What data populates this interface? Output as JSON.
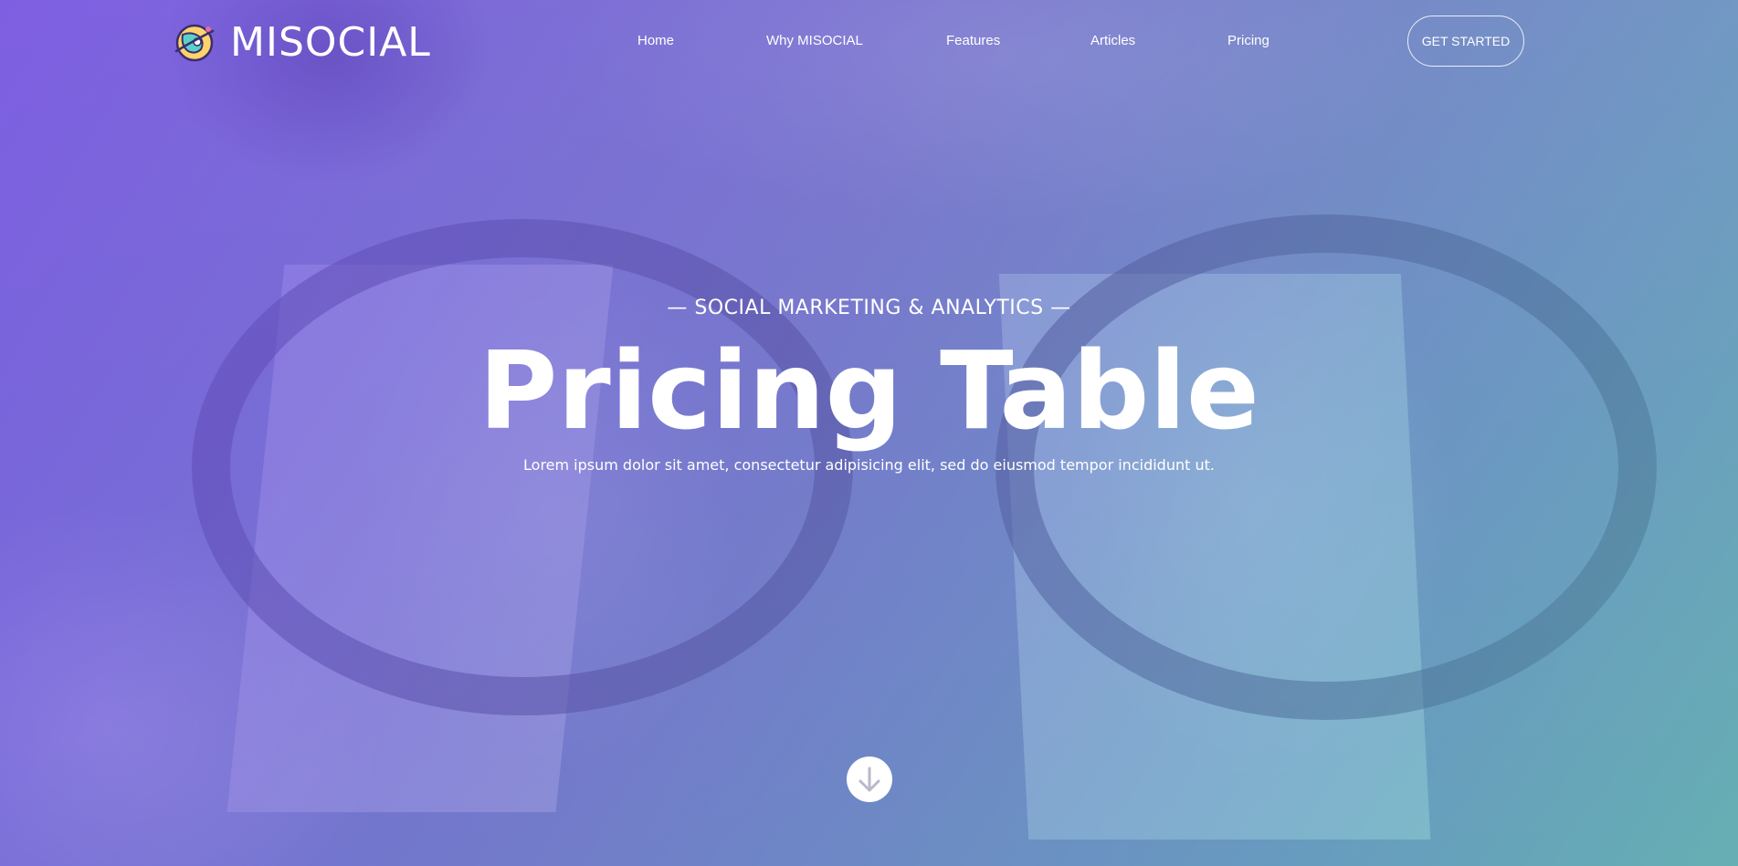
{
  "brand": {
    "name": "MISOCIAL",
    "icon": "planet-logo-icon"
  },
  "nav": {
    "items": [
      {
        "label": "Home"
      },
      {
        "label": "Why MISOCIAL"
      },
      {
        "label": "Features"
      },
      {
        "label": "Articles"
      },
      {
        "label": "Pricing"
      }
    ],
    "cta_label": "GET STARTED"
  },
  "hero": {
    "eyebrow": "— SOCIAL MARKETING & ANALYTICS —",
    "title": "Pricing Table",
    "subtitle": "Lorem ipsum dolor sit amet, consectetur adipisicing elit, sed do eiusmod tempor incididunt ut.",
    "scroll_icon": "arrow-down-icon"
  },
  "colors": {
    "overlay_start": "#7850eb",
    "overlay_end": "#5ac8aa",
    "text": "#ffffff",
    "arrow": "#b9b9c8"
  }
}
